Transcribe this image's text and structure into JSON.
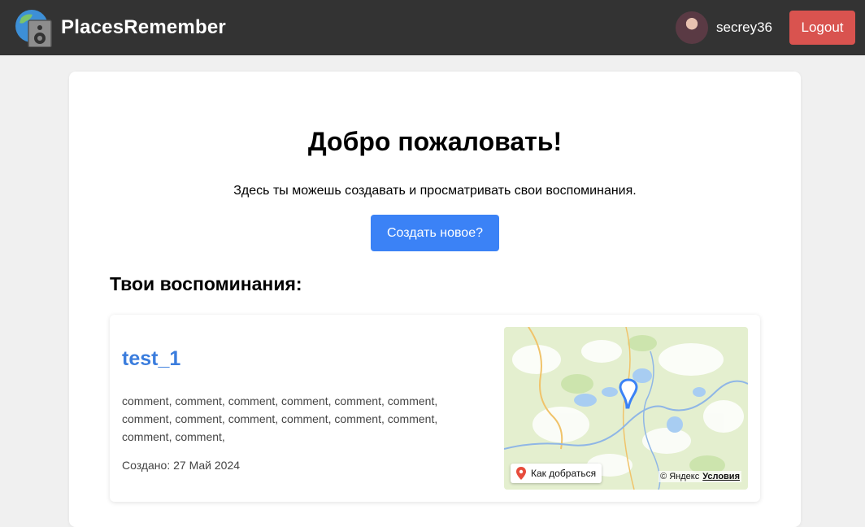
{
  "header": {
    "brand": "PlacesRemember",
    "username": "secrey36",
    "logout_label": "Logout"
  },
  "main": {
    "title": "Добро пожаловать!",
    "subtitle": "Здесь ты можешь создавать и просматривать свои воспоминания.",
    "create_label": "Создать новое?",
    "section_title": "Твои воспоминания:"
  },
  "memories": [
    {
      "title": "test_1",
      "comment": "comment, comment, comment, comment, comment, comment, comment, comment, comment, comment, comment, comment, comment, comment,",
      "created": "Создано: 27 Май 2024",
      "map": {
        "route_label": "Как добраться",
        "attribution": "© Яндекс",
        "terms_label": "Условия"
      }
    }
  ],
  "colors": {
    "topbar": "#333333",
    "logout": "#d9534f",
    "primary": "#3b82f6",
    "link": "#3b7ddd",
    "page_bg": "#f0f0f0"
  }
}
